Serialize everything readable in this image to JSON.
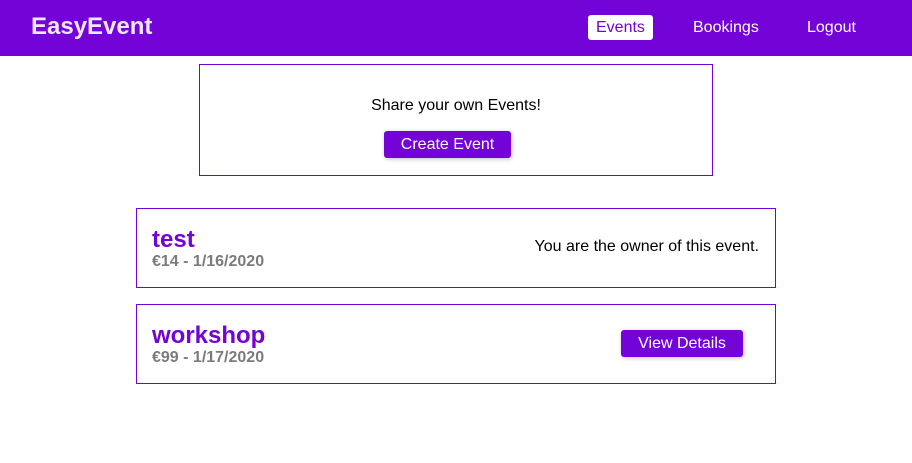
{
  "navbar": {
    "logo": "EasyEvent",
    "items": [
      {
        "label": "Events",
        "active": true
      },
      {
        "label": "Bookings",
        "active": false
      },
      {
        "label": "Logout",
        "active": false
      }
    ]
  },
  "create_section": {
    "text": "Share your own Events!",
    "button_label": "Create Event"
  },
  "events": [
    {
      "title": "test",
      "price": "€14",
      "date": "1/16/2020",
      "meta": "€14 - 1/16/2020",
      "owner_text": "You are the owner of this event."
    },
    {
      "title": "workshop",
      "price": "€99",
      "date": "1/17/2020",
      "meta": "€99 - 1/17/2020",
      "button_label": "View Details"
    }
  ],
  "colors": {
    "brand": "#7303d6",
    "meta_text": "#7b7b7b",
    "logo_text": "#f0e6fb"
  }
}
